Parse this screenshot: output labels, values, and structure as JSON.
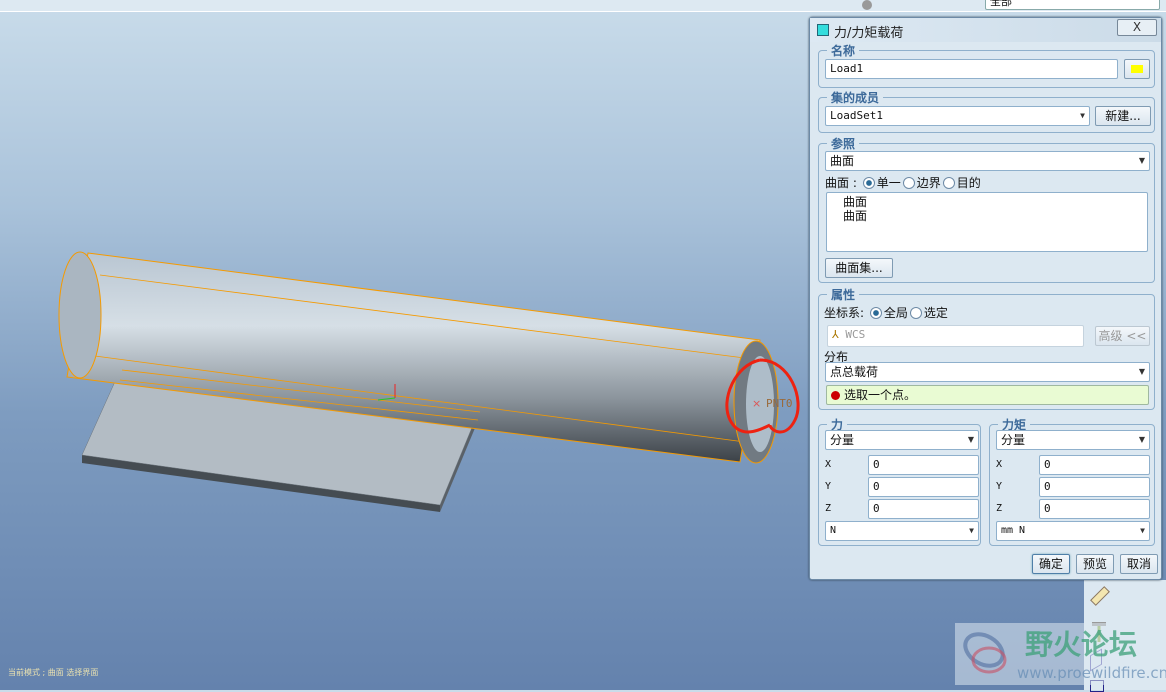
{
  "toolbar": {
    "filter_value": "全部"
  },
  "status_bar": {
    "text": "当前模式 ; 曲面 选择界面"
  },
  "viewport": {
    "point_label": "PNT0"
  },
  "dialog": {
    "title": "力/力矩载荷",
    "close_label": "X",
    "name": {
      "legend": "名称",
      "value": "Load1"
    },
    "member_of_set": {
      "legend": "集的成员",
      "value": "LoadSet1",
      "new_button": "新建..."
    },
    "references": {
      "legend": "参照",
      "type_value": "曲面",
      "surface_label": "曲面 :",
      "options": [
        "单一",
        "边界",
        "目的"
      ],
      "selected": "单一",
      "list_items": [
        "曲面",
        "曲面"
      ],
      "surface_sets_button": "曲面集..."
    },
    "properties": {
      "legend": "属性",
      "csys_label": "坐标系:",
      "csys_options": [
        "全局",
        "选定"
      ],
      "csys_selected": "全局",
      "csys_value": "WCS",
      "advanced_button": "高级 <<",
      "distribution_label": "分布",
      "distribution_value": "点总载荷",
      "prompt": "选取一个点。"
    },
    "force": {
      "legend": "力",
      "mode": "分量",
      "x": "0",
      "y": "0",
      "z": "0",
      "unit": "N",
      "labels": [
        "X",
        "Y",
        "Z"
      ]
    },
    "moment": {
      "legend": "力矩",
      "mode": "分量",
      "x": "0",
      "y": "0",
      "z": "0",
      "unit": "mm N",
      "labels": [
        "X",
        "Y",
        "Z"
      ]
    },
    "buttons": {
      "ok": "确定",
      "preview": "预览",
      "cancel": "取消"
    }
  },
  "watermark": {
    "name": "野火论坛",
    "url": "www.proewildfire.cn"
  }
}
